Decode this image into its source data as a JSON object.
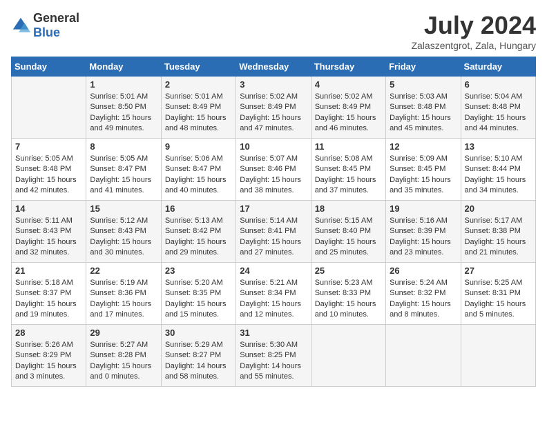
{
  "header": {
    "logo_general": "General",
    "logo_blue": "Blue",
    "month_title": "July 2024",
    "location": "Zalaszentgrot, Zala, Hungary"
  },
  "columns": [
    "Sunday",
    "Monday",
    "Tuesday",
    "Wednesday",
    "Thursday",
    "Friday",
    "Saturday"
  ],
  "weeks": [
    [
      {
        "day": "",
        "info": ""
      },
      {
        "day": "1",
        "info": "Sunrise: 5:01 AM\nSunset: 8:50 PM\nDaylight: 15 hours\nand 49 minutes."
      },
      {
        "day": "2",
        "info": "Sunrise: 5:01 AM\nSunset: 8:49 PM\nDaylight: 15 hours\nand 48 minutes."
      },
      {
        "day": "3",
        "info": "Sunrise: 5:02 AM\nSunset: 8:49 PM\nDaylight: 15 hours\nand 47 minutes."
      },
      {
        "day": "4",
        "info": "Sunrise: 5:02 AM\nSunset: 8:49 PM\nDaylight: 15 hours\nand 46 minutes."
      },
      {
        "day": "5",
        "info": "Sunrise: 5:03 AM\nSunset: 8:48 PM\nDaylight: 15 hours\nand 45 minutes."
      },
      {
        "day": "6",
        "info": "Sunrise: 5:04 AM\nSunset: 8:48 PM\nDaylight: 15 hours\nand 44 minutes."
      }
    ],
    [
      {
        "day": "7",
        "info": "Sunrise: 5:05 AM\nSunset: 8:48 PM\nDaylight: 15 hours\nand 42 minutes."
      },
      {
        "day": "8",
        "info": "Sunrise: 5:05 AM\nSunset: 8:47 PM\nDaylight: 15 hours\nand 41 minutes."
      },
      {
        "day": "9",
        "info": "Sunrise: 5:06 AM\nSunset: 8:47 PM\nDaylight: 15 hours\nand 40 minutes."
      },
      {
        "day": "10",
        "info": "Sunrise: 5:07 AM\nSunset: 8:46 PM\nDaylight: 15 hours\nand 38 minutes."
      },
      {
        "day": "11",
        "info": "Sunrise: 5:08 AM\nSunset: 8:45 PM\nDaylight: 15 hours\nand 37 minutes."
      },
      {
        "day": "12",
        "info": "Sunrise: 5:09 AM\nSunset: 8:45 PM\nDaylight: 15 hours\nand 35 minutes."
      },
      {
        "day": "13",
        "info": "Sunrise: 5:10 AM\nSunset: 8:44 PM\nDaylight: 15 hours\nand 34 minutes."
      }
    ],
    [
      {
        "day": "14",
        "info": "Sunrise: 5:11 AM\nSunset: 8:43 PM\nDaylight: 15 hours\nand 32 minutes."
      },
      {
        "day": "15",
        "info": "Sunrise: 5:12 AM\nSunset: 8:43 PM\nDaylight: 15 hours\nand 30 minutes."
      },
      {
        "day": "16",
        "info": "Sunrise: 5:13 AM\nSunset: 8:42 PM\nDaylight: 15 hours\nand 29 minutes."
      },
      {
        "day": "17",
        "info": "Sunrise: 5:14 AM\nSunset: 8:41 PM\nDaylight: 15 hours\nand 27 minutes."
      },
      {
        "day": "18",
        "info": "Sunrise: 5:15 AM\nSunset: 8:40 PM\nDaylight: 15 hours\nand 25 minutes."
      },
      {
        "day": "19",
        "info": "Sunrise: 5:16 AM\nSunset: 8:39 PM\nDaylight: 15 hours\nand 23 minutes."
      },
      {
        "day": "20",
        "info": "Sunrise: 5:17 AM\nSunset: 8:38 PM\nDaylight: 15 hours\nand 21 minutes."
      }
    ],
    [
      {
        "day": "21",
        "info": "Sunrise: 5:18 AM\nSunset: 8:37 PM\nDaylight: 15 hours\nand 19 minutes."
      },
      {
        "day": "22",
        "info": "Sunrise: 5:19 AM\nSunset: 8:36 PM\nDaylight: 15 hours\nand 17 minutes."
      },
      {
        "day": "23",
        "info": "Sunrise: 5:20 AM\nSunset: 8:35 PM\nDaylight: 15 hours\nand 15 minutes."
      },
      {
        "day": "24",
        "info": "Sunrise: 5:21 AM\nSunset: 8:34 PM\nDaylight: 15 hours\nand 12 minutes."
      },
      {
        "day": "25",
        "info": "Sunrise: 5:23 AM\nSunset: 8:33 PM\nDaylight: 15 hours\nand 10 minutes."
      },
      {
        "day": "26",
        "info": "Sunrise: 5:24 AM\nSunset: 8:32 PM\nDaylight: 15 hours\nand 8 minutes."
      },
      {
        "day": "27",
        "info": "Sunrise: 5:25 AM\nSunset: 8:31 PM\nDaylight: 15 hours\nand 5 minutes."
      }
    ],
    [
      {
        "day": "28",
        "info": "Sunrise: 5:26 AM\nSunset: 8:29 PM\nDaylight: 15 hours\nand 3 minutes."
      },
      {
        "day": "29",
        "info": "Sunrise: 5:27 AM\nSunset: 8:28 PM\nDaylight: 15 hours\nand 0 minutes."
      },
      {
        "day": "30",
        "info": "Sunrise: 5:29 AM\nSunset: 8:27 PM\nDaylight: 14 hours\nand 58 minutes."
      },
      {
        "day": "31",
        "info": "Sunrise: 5:30 AM\nSunset: 8:25 PM\nDaylight: 14 hours\nand 55 minutes."
      },
      {
        "day": "",
        "info": ""
      },
      {
        "day": "",
        "info": ""
      },
      {
        "day": "",
        "info": ""
      }
    ]
  ]
}
